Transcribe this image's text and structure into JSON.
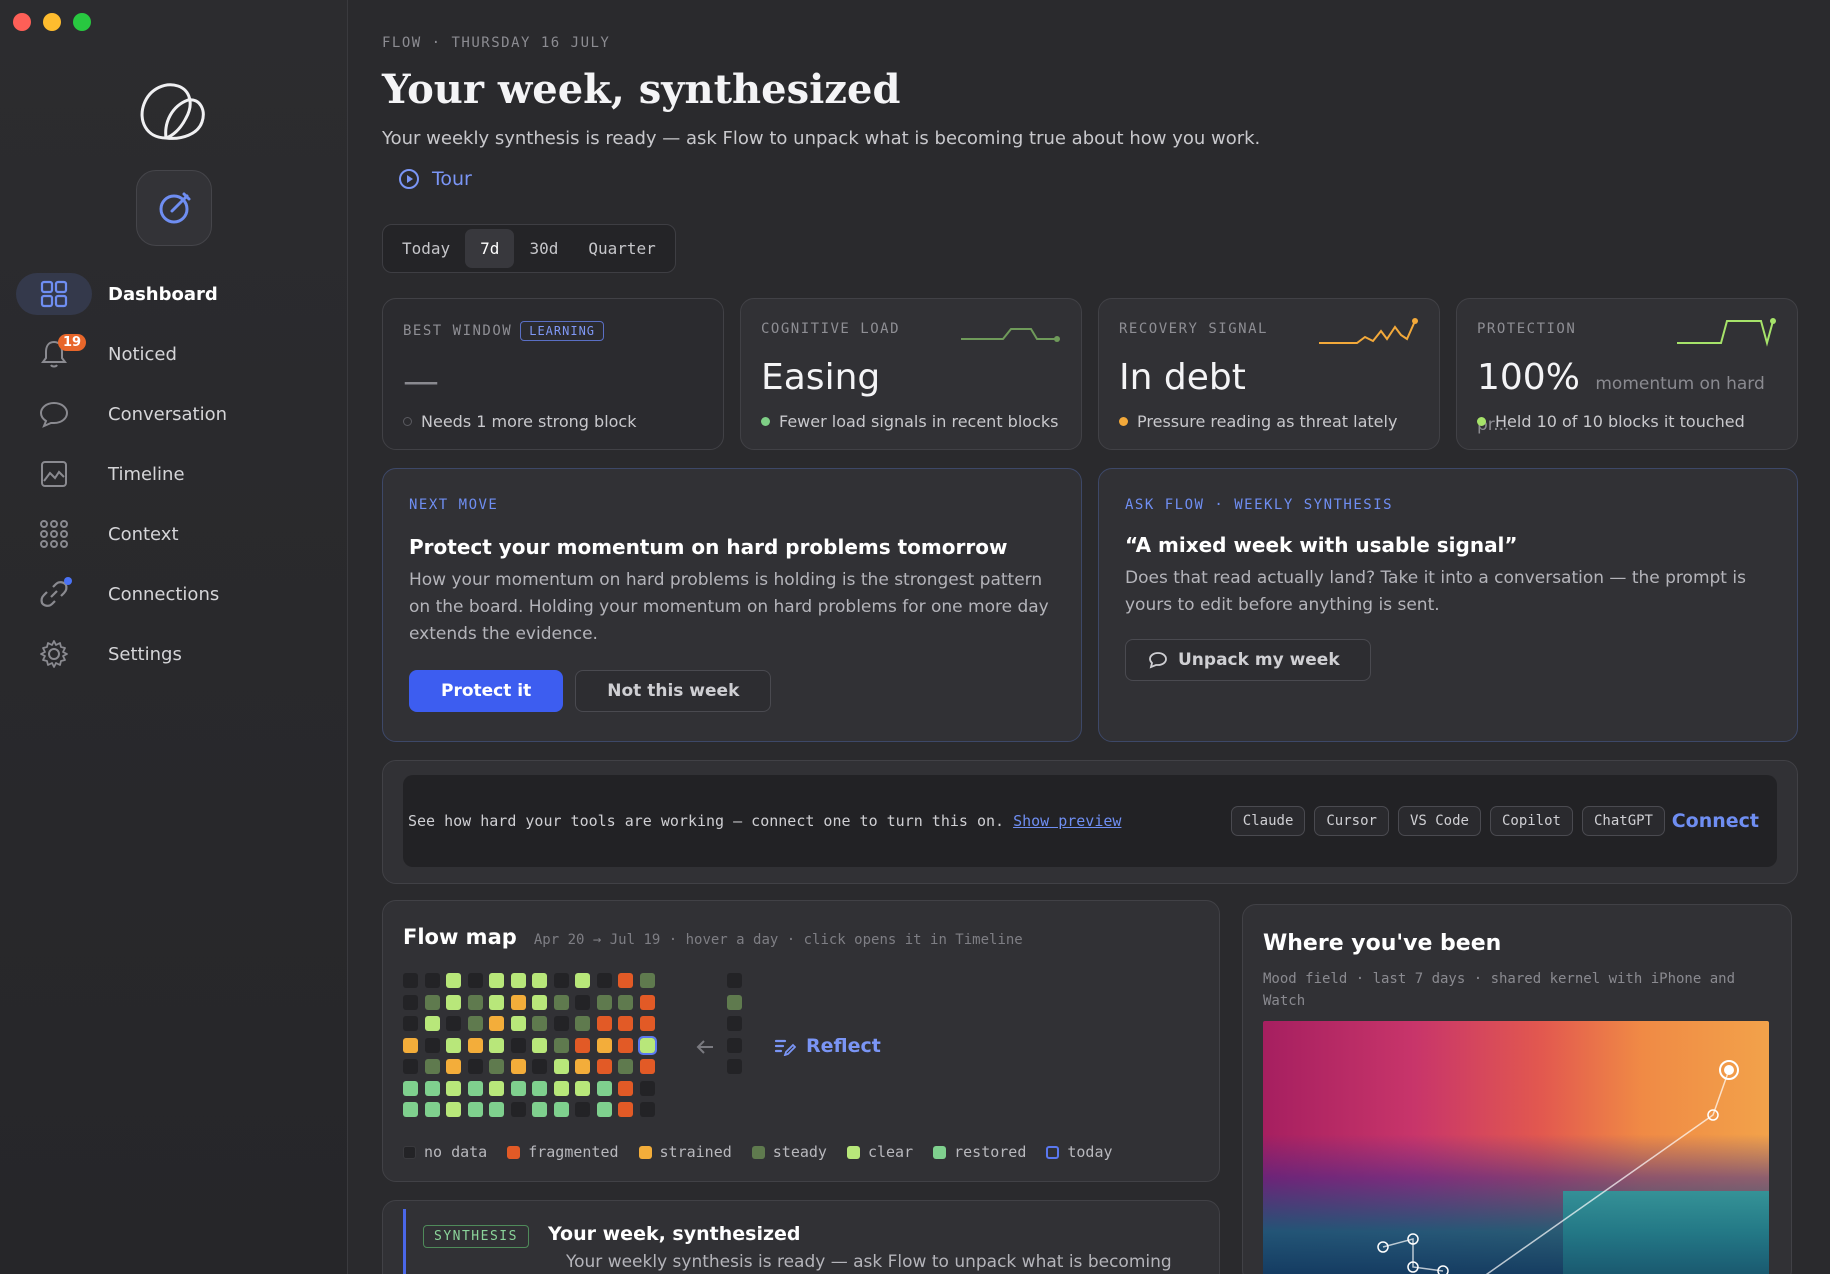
{
  "sidebar": {
    "items": [
      {
        "label": "Dashboard",
        "icon": "grid-icon",
        "active": true
      },
      {
        "label": "Noticed",
        "icon": "bell-icon",
        "badge": "19"
      },
      {
        "label": "Conversation",
        "icon": "chat-bubble-icon"
      },
      {
        "label": "Timeline",
        "icon": "image-chart-icon"
      },
      {
        "label": "Context",
        "icon": "dots-grid-icon"
      },
      {
        "label": "Connections",
        "icon": "link-icon",
        "dot": true
      },
      {
        "label": "Settings",
        "icon": "gear-icon"
      }
    ]
  },
  "header": {
    "eyebrow": "FLOW · THURSDAY 16 JULY",
    "title": "Your week, synthesized",
    "subtitle": "Your weekly synthesis is ready — ask Flow to unpack what is becoming true about how you work.",
    "tour_label": "Tour"
  },
  "range": {
    "options": [
      "Today",
      "7d",
      "30d",
      "Quarter"
    ],
    "selected": "7d"
  },
  "metrics": [
    {
      "label": "BEST WINDOW",
      "tag": "LEARNING",
      "value": "—",
      "note": "Needs 1 more strong block",
      "dot_color": "#4a4a50"
    },
    {
      "label": "COGNITIVE LOAD",
      "value": "Easing",
      "note": "Fewer load signals in recent blocks",
      "dot_color": "#7fcf86",
      "spark_color": "#6f9a5a"
    },
    {
      "label": "RECOVERY SIGNAL",
      "value": "In debt",
      "note": "Pressure reading as threat lately",
      "dot_color": "#f3a93a",
      "spark_color": "#f3a93a"
    },
    {
      "label": "PROTECTION",
      "value": "100%",
      "value_suffix": "momentum on hard pr...",
      "note": "Held 10 of 10 blocks it touched",
      "dot_color": "#a6e36a",
      "spark_color": "#a6e36a"
    }
  ],
  "next_move": {
    "eyebrow": "NEXT MOVE",
    "title": "Protect your momentum on hard problems tomorrow",
    "body": "How your momentum on hard problems is holding is the strongest pattern on the board. Holding your momentum on hard problems for one more day extends the evidence.",
    "primary": "Protect it",
    "secondary": "Not this week"
  },
  "ask_flow": {
    "eyebrow": "ASK FLOW · WEEKLY SYNTHESIS",
    "quote": "“A mixed week with usable signal”",
    "body": "Does that read actually land? Take it into a conversation — the prompt is yours to edit before anything is sent.",
    "button": "Unpack my week"
  },
  "connect": {
    "text": "See how hard your tools are working — connect one to turn this on.",
    "link": "Show preview",
    "tools": [
      "Claude",
      "Cursor",
      "VS Code",
      "Copilot",
      "ChatGPT"
    ],
    "action": "Connect"
  },
  "flow_map": {
    "title": "Flow map",
    "hint": "Apr 20 → Jul 19 · hover a day · click opens it in Timeline",
    "reflect": "Reflect",
    "legend": [
      {
        "label": "no data",
        "color": "#232326"
      },
      {
        "label": "fragmented",
        "color": "#e25a26"
      },
      {
        "label": "strained",
        "color": "#f3ad3a"
      },
      {
        "label": "steady",
        "color": "#5f7a4e"
      },
      {
        "label": "clear",
        "color": "#b8e77a"
      },
      {
        "label": "restored",
        "color": "#7fd08e"
      },
      {
        "label": "today",
        "color": "#5a78f0"
      }
    ],
    "grid": [
      "ddcdcccdcdfs",
      "dsc cscsdssf",
      "dcdsscsdsfff",
      "sdcscdcsfsft",
      "dssdssdcsfsf",
      "rrcrcrrccrfd",
      "rrcrrdrrdrfd"
    ]
  },
  "been": {
    "title": "Where you've been",
    "hint": "Mood field · last 7 days · shared kernel with iPhone and Watch"
  },
  "synthesis": {
    "tag": "SYNTHESIS",
    "title": "Your week, synthesized",
    "body": "Your weekly synthesis is ready — ask Flow to unpack what is becoming true"
  },
  "colors": {
    "accent": "#3d5df0",
    "link": "#6f8ef2"
  }
}
